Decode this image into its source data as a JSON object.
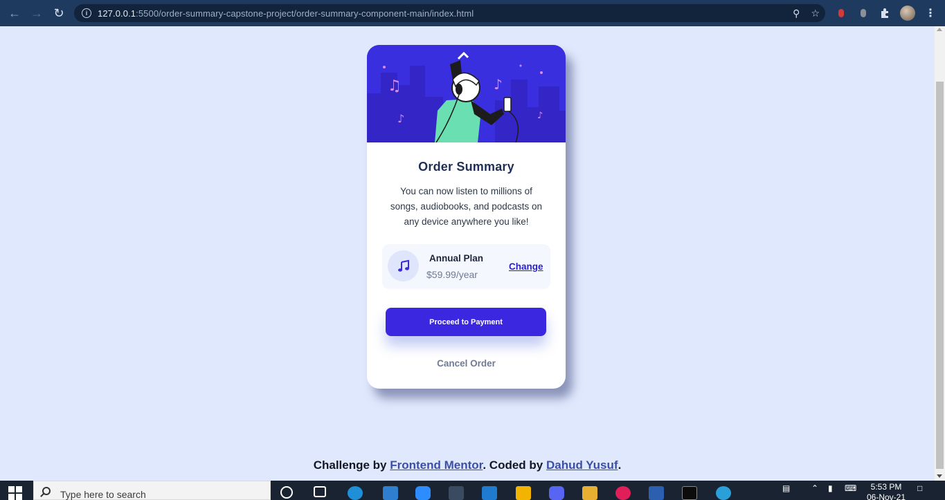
{
  "browser": {
    "url_host": "127.0.0.1",
    "url_path": ":5500/order-summary-capstone-project/order-summary-component-main/index.html"
  },
  "card": {
    "title": "Order Summary",
    "description": "You can now listen to millions of songs, audiobooks, and podcasts on any device anywhere you like!",
    "plan_name": "Annual Plan",
    "plan_price": "$59.99/year",
    "change_label": "Change",
    "pay_label": "Proceed to Payment",
    "cancel_label": "Cancel Order"
  },
  "footer": {
    "prefix": "Challenge by ",
    "link1": "Frontend Mentor",
    "middle": ". Coded by ",
    "link2": "Dahud Yusuf",
    "suffix": "."
  },
  "taskbar": {
    "search_placeholder": "Type here to search",
    "time": "5:53 PM",
    "date": "06-Nov-21"
  },
  "colors": {
    "page_bg": "#e0e8fd",
    "primary": "#3a27df",
    "title": "#1f2f56",
    "muted": "#6f7a94"
  }
}
